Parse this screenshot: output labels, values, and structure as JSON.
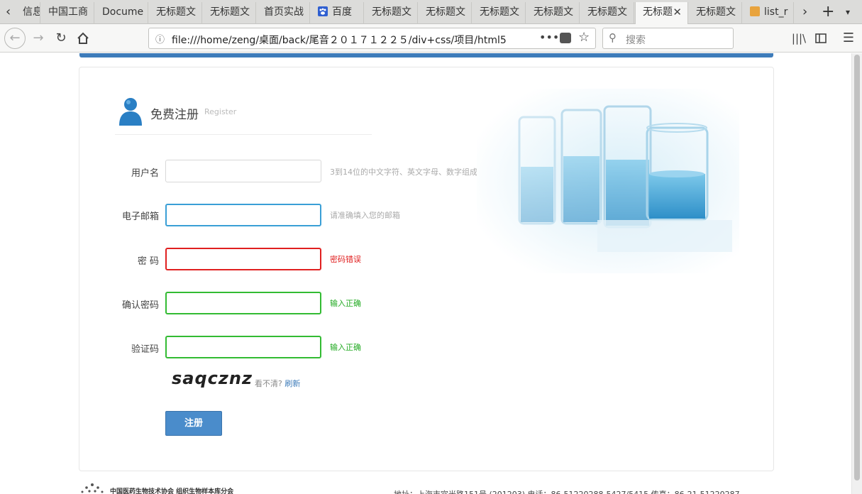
{
  "browser": {
    "tabs": [
      {
        "label": "信息"
      },
      {
        "label": "中国工商"
      },
      {
        "label": "Docume"
      },
      {
        "label": "无标题文"
      },
      {
        "label": "无标题文"
      },
      {
        "label": "首页实战"
      },
      {
        "label": "百度"
      },
      {
        "label": "无标题文"
      },
      {
        "label": "无标题文"
      },
      {
        "label": "无标题文"
      },
      {
        "label": "无标题文"
      },
      {
        "label": "无标题文"
      },
      {
        "label": "无标题"
      },
      {
        "label": "无标题文"
      },
      {
        "label": "list_r"
      }
    ],
    "url": "file:///home/zeng/桌面/back/尾音２０１７１２２５/div+css/项目/html5",
    "search_placeholder": "搜索"
  },
  "form": {
    "title": "免费注册",
    "subtitle": "Register",
    "fields": [
      {
        "label": "用户名",
        "hint": "3到14位的中文字符、英文字母、数字组成",
        "state": "default",
        "border": "#d8d8d8",
        "hint_color": "#aaaaaa"
      },
      {
        "label": "电子邮箱",
        "hint": "请准确填入您的邮箱",
        "state": "focus",
        "border": "#3a9fd6",
        "hint_color": "#aaaaaa"
      },
      {
        "label": "密  码",
        "hint": "密码错误",
        "state": "error",
        "border": "#e02020",
        "hint_color": "#e02020"
      },
      {
        "label": "确认密码",
        "hint": "输入正确",
        "state": "ok",
        "border": "#33bb33",
        "hint_color": "#22aa22"
      },
      {
        "label": "验证码",
        "hint": "输入正确",
        "state": "ok",
        "border": "#33bb33",
        "hint_color": "#22aa22"
      }
    ],
    "captcha_text": "saqcznz",
    "captcha_unclear": "看不清?",
    "captcha_refresh": "刷新",
    "submit_label": "注册"
  },
  "footer": {
    "org": "中国医药生物技术协会 组织生物样本库分会",
    "address": "地址：上海市宜光路151号 (201203)    电话：86-51220288-5427/5415    传真：86-21-51220287"
  },
  "colors": {
    "accent": "#3e7cba",
    "button": "#4a8ccb"
  }
}
